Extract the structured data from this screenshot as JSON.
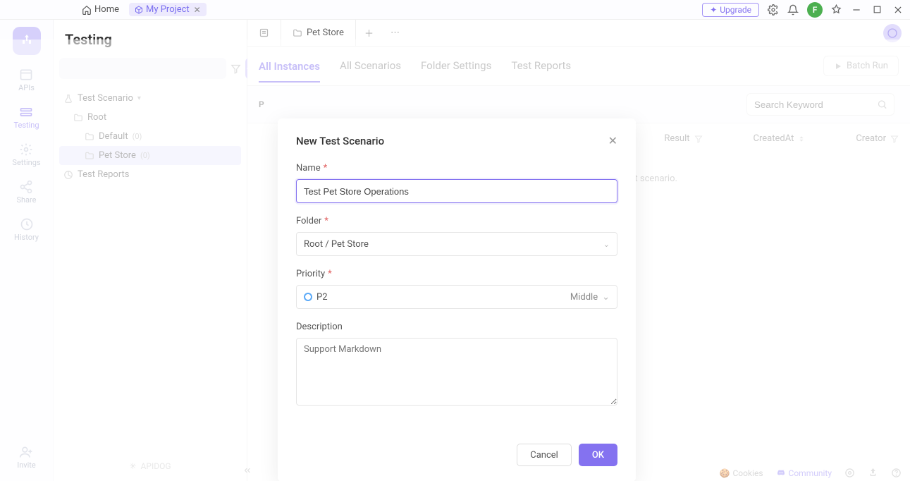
{
  "topbar": {
    "home_label": "Home",
    "project_label": "My Project",
    "upgrade_label": "Upgrade",
    "avatar_initial": "F"
  },
  "rail": {
    "apis": "APIs",
    "testing": "Testing",
    "settings": "Settings",
    "share": "Share",
    "history": "History",
    "invite": "Invite"
  },
  "sidebar": {
    "title": "Testing",
    "search_placeholder": "",
    "tree": {
      "scenario_label": "Test Scenario",
      "root_label": "Root",
      "default_label": "Default",
      "default_count": "(0)",
      "petstore_label": "Pet Store",
      "petstore_count": "(0)",
      "reports_label": "Test Reports"
    },
    "footer_brand": "APIDOG"
  },
  "mainTabs": {
    "overview_icon": "overview",
    "petstore_label": "Pet Store"
  },
  "subTabs": {
    "all_instances": "All Instances",
    "all_scenarios": "All Scenarios",
    "folder_settings": "Folder Settings",
    "test_reports": "Test Reports",
    "batch_run": "Batch Run"
  },
  "tableArea": {
    "left_prefix": "P",
    "search_placeholder": "Search Keyword",
    "col_result": "Result",
    "col_created": "CreatedAt",
    "col_creator": "Creator",
    "empty_hint": "the test scenario."
  },
  "bottom": {
    "cookies": "Cookies",
    "community": "Community"
  },
  "modal": {
    "title": "New Test Scenario",
    "name_label": "Name",
    "name_value": "Test Pet Store Operations",
    "folder_label": "Folder",
    "folder_value": "Root / Pet Store",
    "priority_label": "Priority",
    "priority_code": "P2",
    "priority_level": "Middle",
    "description_label": "Description",
    "description_placeholder": "Support Markdown",
    "cancel": "Cancel",
    "ok": "OK"
  }
}
